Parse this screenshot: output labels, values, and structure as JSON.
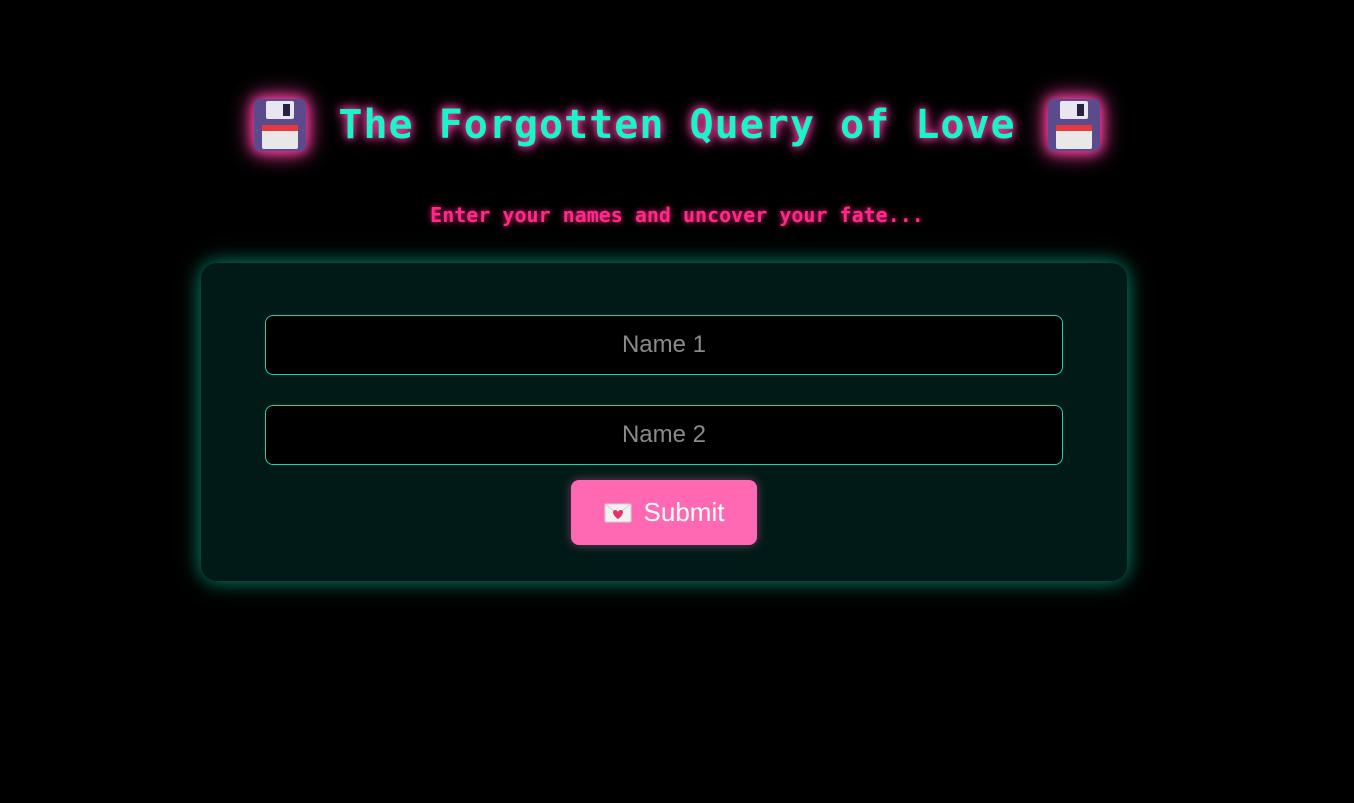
{
  "header": {
    "title": "The Forgotten Query of Love",
    "left_icon": "floppy-disk-icon",
    "right_icon": "floppy-disk-icon",
    "subtitle": "Enter your names and uncover your fate..."
  },
  "form": {
    "name1_placeholder": "Name 1",
    "name1_value": "",
    "name2_placeholder": "Name 2",
    "name2_value": "",
    "submit_label": "Submit",
    "submit_icon": "love-letter-icon"
  },
  "colors": {
    "background": "#000000",
    "title": "#19f5c8",
    "title_glow": "#ff3fa4",
    "subtitle": "#ff2a86",
    "card": "#011a17",
    "input_border": "#19d4a8",
    "button": "#ff69b4"
  }
}
